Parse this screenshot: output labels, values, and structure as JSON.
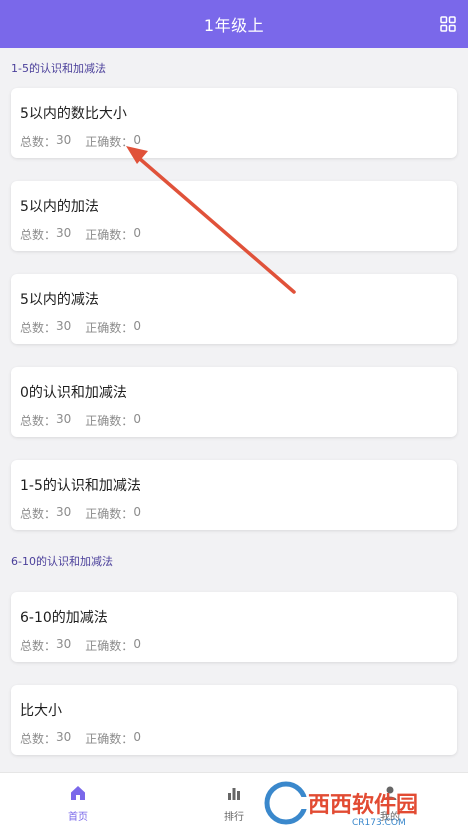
{
  "header": {
    "title": "1年级上",
    "menu_icon": "grid-icon",
    "color": "#7a68ea"
  },
  "sections": [
    {
      "title": "1-5的认识和加减法",
      "items": [
        {
          "title": "5以内的数比大小",
          "total_label": "总数：",
          "total": "30",
          "correct_label": "正确数：",
          "correct": "0"
        },
        {
          "title": "5以内的加法",
          "total_label": "总数：",
          "total": "30",
          "correct_label": "正确数：",
          "correct": "0"
        },
        {
          "title": "5以内的减法",
          "total_label": "总数：",
          "total": "30",
          "correct_label": "正确数：",
          "correct": "0"
        },
        {
          "title": "0的认识和加减法",
          "total_label": "总数：",
          "total": "30",
          "correct_label": "正确数：",
          "correct": "0"
        },
        {
          "title": "1-5的认识和加减法",
          "total_label": "总数：",
          "total": "30",
          "correct_label": "正确数：",
          "correct": "0"
        }
      ]
    },
    {
      "title": "6-10的认识和加减法",
      "items": [
        {
          "title": "6-10的加减法",
          "total_label": "总数：",
          "total": "30",
          "correct_label": "正确数：",
          "correct": "0"
        },
        {
          "title": "比大小",
          "total_label": "总数：",
          "total": "30",
          "correct_label": "正确数：",
          "correct": "0"
        }
      ]
    }
  ],
  "bottom_nav": [
    {
      "label": "首页",
      "icon": "home-icon",
      "active": true
    },
    {
      "label": "排行",
      "icon": "bar-chart-icon",
      "active": false
    },
    {
      "label": "我的",
      "icon": "user-icon",
      "active": false
    }
  ],
  "watermark": {
    "text": "西西软件园",
    "sub": "CR173.COM"
  },
  "colors": {
    "accent": "#7a68ea",
    "arrow": "#e0523a"
  }
}
